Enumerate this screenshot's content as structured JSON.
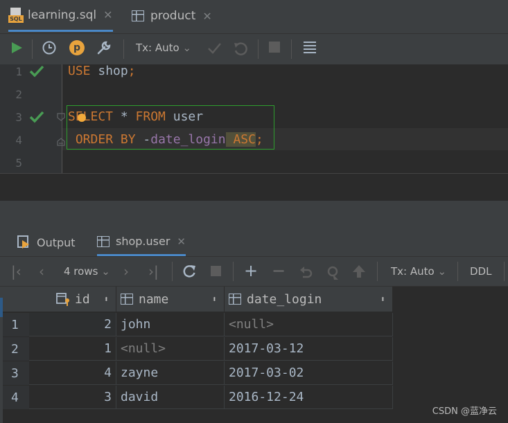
{
  "editor_tabs": [
    {
      "label": "learning.sql",
      "icon": "sql-file-icon",
      "active": true
    },
    {
      "label": "product",
      "icon": "table-icon",
      "active": false
    }
  ],
  "toolbar": {
    "tx_mode": "Tx: Auto"
  },
  "editor": {
    "line_numbers": [
      "1",
      "2",
      "3",
      "4",
      "5"
    ],
    "lines": [
      {
        "kw1": "USE",
        "rest": " shop",
        "semi": ";"
      },
      {},
      {
        "kw1": "SELECT",
        "star": " * ",
        "kw2": "FROM",
        "rest": " user"
      },
      {
        "kw1": "ORDER BY",
        "minus": " -",
        "field": "date_login",
        "asc": " ASC",
        "semi": ";"
      },
      {}
    ]
  },
  "services": {
    "output_label": "Output",
    "result_tab_label": "shop.user"
  },
  "grid_toolbar": {
    "rows_label": "4 rows",
    "tx_mode": "Tx: Auto",
    "ddl_label": "DDL"
  },
  "grid": {
    "columns": [
      "id",
      "name",
      "date_login"
    ],
    "rows": [
      {
        "num": "1",
        "id": "2",
        "name": "john",
        "date_login": "<null>"
      },
      {
        "num": "2",
        "id": "1",
        "name": "<null>",
        "date_login": "2017-03-12"
      },
      {
        "num": "3",
        "id": "4",
        "name": "zayne",
        "date_login": "2017-03-02"
      },
      {
        "num": "4",
        "id": "3",
        "name": "david",
        "date_login": "2016-12-24"
      }
    ]
  },
  "watermark": "CSDN @蓝净云",
  "colors": {
    "keyword": "#cc7832",
    "field": "#9876aa",
    "run_green": "#499c54",
    "accent_blue": "#4a88c7",
    "highlight_box": "#2e9e2e"
  }
}
